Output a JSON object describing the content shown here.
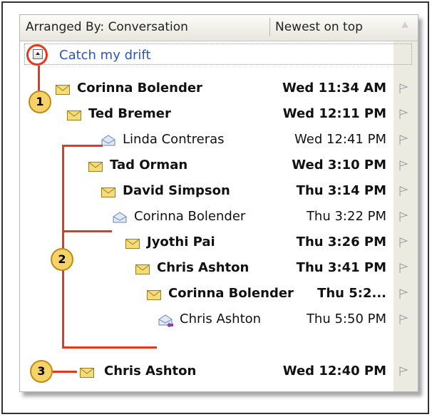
{
  "header": {
    "arranged_by": "Arranged By: Conversation",
    "sort_order": "Newest on top"
  },
  "conversation": {
    "title": "Catch my drift",
    "messages": [
      {
        "sender": "Corinna Bolender",
        "date": "Wed 11:34 AM",
        "unread": true,
        "icon": "envelope-closed-icon"
      },
      {
        "sender": "Ted Bremer",
        "date": "Wed 12:11 PM",
        "unread": true,
        "icon": "envelope-closed-icon"
      },
      {
        "sender": "Linda Contreras",
        "date": "Wed 12:41 PM",
        "unread": false,
        "icon": "envelope-open-icon"
      },
      {
        "sender": "Tad Orman",
        "date": "Wed 3:10 PM",
        "unread": true,
        "icon": "envelope-closed-icon"
      },
      {
        "sender": "David Simpson",
        "date": "Thu 3:14 PM",
        "unread": true,
        "icon": "envelope-closed-icon"
      },
      {
        "sender": "Corinna Bolender",
        "date": "Thu 3:22 PM",
        "unread": false,
        "icon": "envelope-open-icon"
      },
      {
        "sender": "Jyothi Pai",
        "date": "Thu 3:26 PM",
        "unread": true,
        "icon": "envelope-closed-icon"
      },
      {
        "sender": "Chris Ashton",
        "date": "Thu 3:41 PM",
        "unread": true,
        "icon": "envelope-closed-icon"
      },
      {
        "sender": "Corinna Bolender",
        "date": "Thu 5:2...",
        "unread": true,
        "icon": "envelope-closed-icon"
      },
      {
        "sender": "Chris Ashton",
        "date": "Thu 5:50 PM",
        "unread": false,
        "icon": "envelope-replied-icon"
      }
    ]
  },
  "standalone": {
    "sender": "Chris Ashton",
    "date": "Wed 12:40 PM",
    "unread": true,
    "icon": "envelope-closed-icon"
  },
  "callouts": [
    "1",
    "2",
    "3"
  ],
  "colors": {
    "accent": "#e8381c",
    "badge": "#f6d36a",
    "link": "#2a55c0",
    "flag_column": "#ecebe2"
  }
}
